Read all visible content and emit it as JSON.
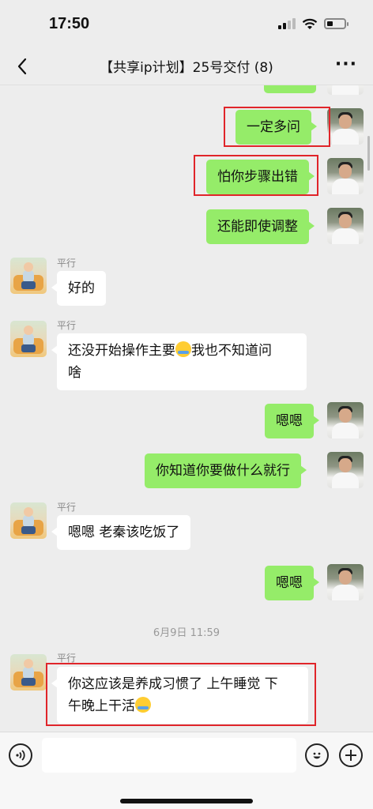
{
  "status_bar": {
    "time": "17:50"
  },
  "nav": {
    "title": "【共享ip计划】25号交付 (8)",
    "back_icon": "chevron-left-icon",
    "more_icon": "more-dots-icon"
  },
  "messages": [
    {
      "from": "me",
      "text": "一定多问",
      "highlighted": true
    },
    {
      "from": "me",
      "text": "怕你步骤出错",
      "highlighted": true
    },
    {
      "from": "me",
      "text": "还能即使调整"
    },
    {
      "from": "other",
      "sender": "平行",
      "text": "好的"
    },
    {
      "from": "other",
      "sender": "平行",
      "text_line1": "还没开始操作主要",
      "text_line1b": "我也不知道问",
      "text_line2": "啥",
      "emoji": "crying-laughing"
    },
    {
      "from": "me",
      "text": "嗯嗯"
    },
    {
      "from": "me",
      "text": "你知道你要做什么就行"
    },
    {
      "from": "other",
      "sender": "平行",
      "text": "嗯嗯 老秦该吃饭了"
    },
    {
      "from": "me",
      "text": "嗯嗯"
    },
    {
      "timestamp": "6月9日 11:59"
    },
    {
      "from": "other",
      "sender": "平行",
      "text_line1": "你这应该是养成习惯了 上午睡觉 下",
      "text_line2": "午晚上干活",
      "emoji": "crying-laughing",
      "highlighted": true
    }
  ],
  "input_bar": {
    "voice_icon": "voice-icon",
    "emoji_icon": "emoji-icon",
    "plus_icon": "plus-icon"
  },
  "colors": {
    "my_bubble": "#95ec69",
    "other_bubble": "#ffffff",
    "background": "#ededed",
    "highlight": "#e0252a"
  }
}
